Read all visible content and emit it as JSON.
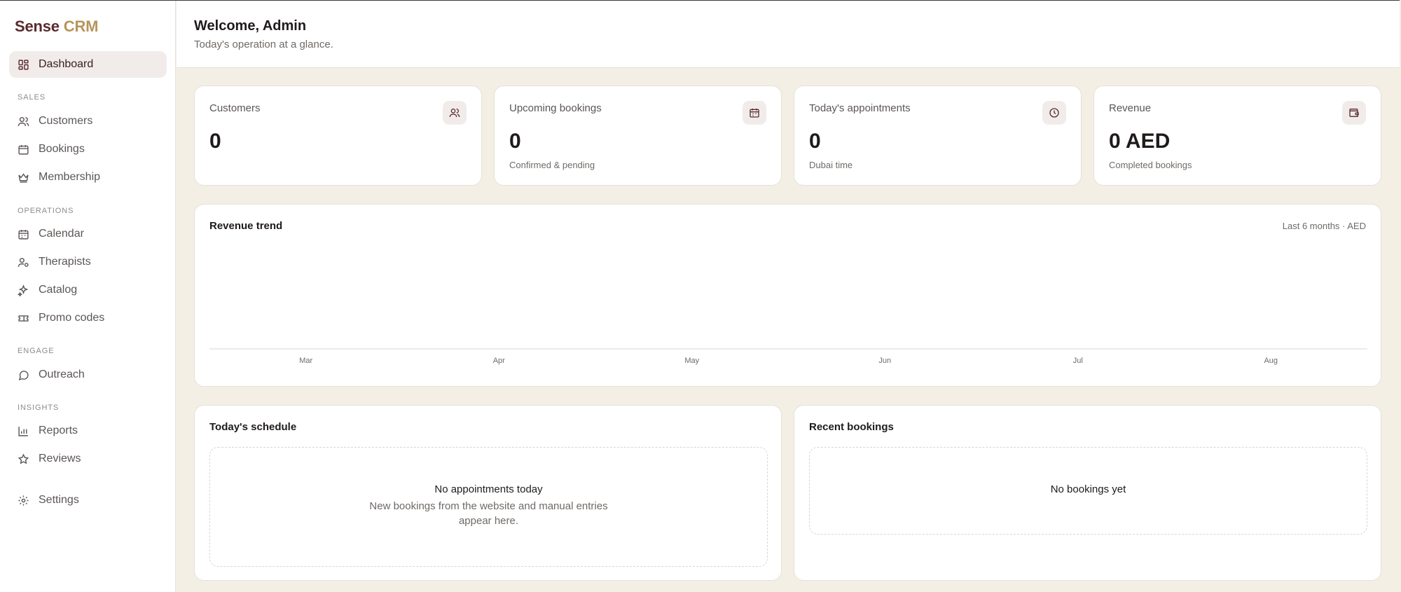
{
  "brand": {
    "part1": "Sense",
    "part2": "CRM"
  },
  "sidebar": {
    "dashboard": "Dashboard",
    "sections": {
      "sales": "SALES",
      "operations": "OPERATIONS",
      "engage": "ENGAGE",
      "insights": "INSIGHTS"
    },
    "items": {
      "customers": "Customers",
      "bookings": "Bookings",
      "membership": "Membership",
      "calendar": "Calendar",
      "therapists": "Therapists",
      "catalog": "Catalog",
      "promo_codes": "Promo codes",
      "outreach": "Outreach",
      "reports": "Reports",
      "reviews": "Reviews",
      "settings": "Settings"
    }
  },
  "header": {
    "title": "Welcome, Admin",
    "subtitle": "Today's operation at a glance."
  },
  "stats": [
    {
      "label": "Customers",
      "value": "0",
      "sub": "",
      "icon": "users-icon"
    },
    {
      "label": "Upcoming bookings",
      "value": "0",
      "sub": "Confirmed & pending",
      "icon": "calendar-icon"
    },
    {
      "label": "Today's appointments",
      "value": "0",
      "sub": "Dubai time",
      "icon": "clock-icon"
    },
    {
      "label": "Revenue",
      "value": "0 AED",
      "sub": "Completed bookings",
      "icon": "wallet-icon"
    }
  ],
  "revenue_chart": {
    "title": "Revenue trend",
    "meta": "Last 6 months · AED"
  },
  "chart_data": {
    "type": "bar",
    "categories": [
      "Mar",
      "Apr",
      "May",
      "Jun",
      "Jul",
      "Aug"
    ],
    "values": [
      0,
      0,
      0,
      0,
      0,
      0
    ],
    "title": "Revenue trend",
    "grid": false,
    "legend": "none"
  },
  "schedule": {
    "title": "Today's schedule",
    "empty_title": "No appointments today",
    "empty_text_line1": "New bookings from the website and manual entries",
    "empty_text_line2": "appear here."
  },
  "recent": {
    "title": "Recent bookings",
    "empty_title": "No bookings yet"
  },
  "colors": {
    "background": "#f3efe5",
    "brand_dark": "#5a2a2e",
    "brand_gold": "#b8955c",
    "active_nav": "#f1ecea"
  }
}
